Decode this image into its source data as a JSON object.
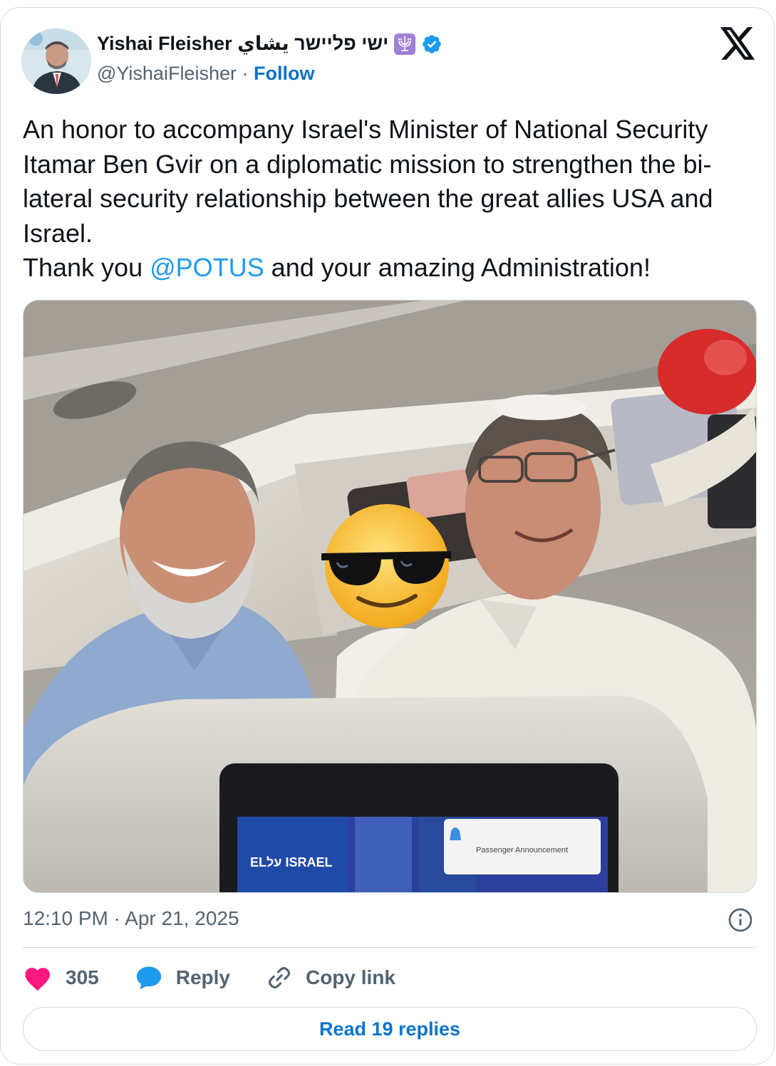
{
  "author": {
    "display_name": "Yishai Fleisher ישי פליישר يشاي",
    "handle": "@YishaiFleisher",
    "separator": "·",
    "follow_label": "Follow",
    "badge_icon": "verified-badge-icon",
    "emoji_icon": "menorah-icon"
  },
  "tweet": {
    "lines": [
      "An honor to accompany Israel's Minister of National Security Itamar Ben Gvir on a diplomatic mission to strengthen the bi-lateral security relationship between the great allies USA and Israel."
    ],
    "thanks_prefix": "Thank you ",
    "mention": "@POTUS",
    "thanks_suffix": " and your amazing Administration!"
  },
  "media": {
    "screen_brand": "ELעל ISRAEL",
    "screen_notice": "Passenger Announcement"
  },
  "meta": {
    "timestamp": "12:10 PM · Apr 21, 2025"
  },
  "actions": {
    "like_count": "305",
    "reply_label": "Reply",
    "copy_link_label": "Copy link"
  },
  "read_replies_label": "Read 19 replies",
  "colors": {
    "like": "#f91880",
    "reply": "#1d9bf0",
    "link": "#0b73c9",
    "verified": "#1d9bf0"
  }
}
